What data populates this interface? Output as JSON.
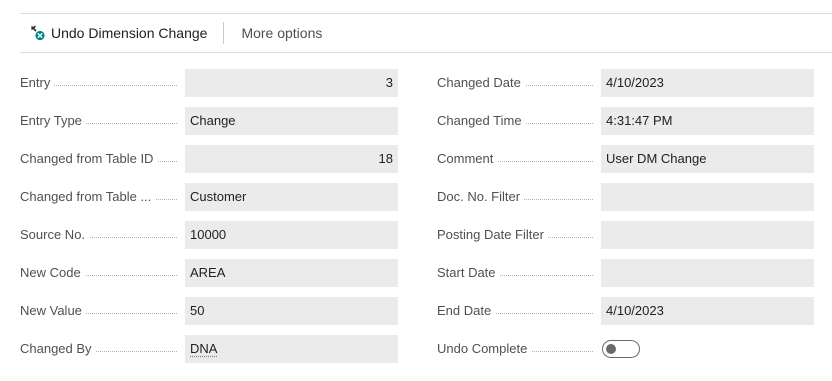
{
  "actionbar": {
    "undo_label": "Undo Dimension Change",
    "more_label": "More options"
  },
  "left_fields": [
    {
      "label": "Entry",
      "value": "3"
    },
    {
      "label": "Entry Type",
      "value": "Change"
    },
    {
      "label": "Changed from Table ID",
      "value": "18"
    },
    {
      "label": "Changed from Table ...",
      "value": "Customer"
    },
    {
      "label": "Source No.",
      "value": "10000"
    },
    {
      "label": "New Code",
      "value": "AREA"
    },
    {
      "label": "New Value",
      "value": "50"
    },
    {
      "label": "Changed By",
      "value": "DNA"
    }
  ],
  "right_fields": [
    {
      "label": "Changed Date",
      "value": "4/10/2023"
    },
    {
      "label": "Changed Time",
      "value": "4:31:47 PM"
    },
    {
      "label": "Comment",
      "value": "User DM Change"
    },
    {
      "label": "Doc. No. Filter",
      "value": ""
    },
    {
      "label": "Posting Date Filter",
      "value": ""
    },
    {
      "label": "Start Date",
      "value": ""
    },
    {
      "label": "End Date",
      "value": "4/10/2023"
    },
    {
      "label": "Undo Complete",
      "toggle_on": false
    }
  ],
  "colors": {
    "accent": "#008489",
    "field_bg": "#ebebeb",
    "label_text": "#505050"
  },
  "icons": {
    "undo_action": "undo-dimension-icon"
  }
}
